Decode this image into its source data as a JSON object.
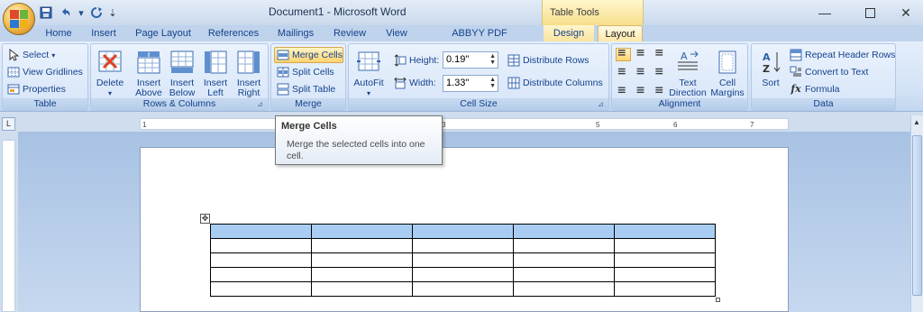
{
  "window": {
    "title": "Document1 - Microsoft Word",
    "context_tools_title": "Table Tools"
  },
  "qat": {
    "undo_icon": "undo-icon",
    "redo_icon": "redo-icon",
    "customize": "▾"
  },
  "tabs": [
    "Home",
    "Insert",
    "Page Layout",
    "References",
    "Mailings",
    "Review",
    "View",
    "ABBYY PDF Transformer+",
    "Design",
    "Layout"
  ],
  "active_tab": "Layout",
  "ribbon": {
    "table_group": {
      "label": "Table",
      "select": "Select",
      "view_gridlines": "View Gridlines",
      "properties": "Properties"
    },
    "rows_cols_group": {
      "label": "Rows & Columns",
      "delete": "Delete",
      "insert_above_1": "Insert",
      "insert_above_2": "Above",
      "insert_below_1": "Insert",
      "insert_below_2": "Below",
      "insert_left_1": "Insert",
      "insert_left_2": "Left",
      "insert_right_1": "Insert",
      "insert_right_2": "Right"
    },
    "merge_group": {
      "label": "Merge",
      "merge_cells": "Merge Cells",
      "split_cells": "Split Cells",
      "split_table": "Split Table"
    },
    "cell_size_group": {
      "label": "Cell Size",
      "autofit": "AutoFit",
      "height_label": "Height:",
      "height_value": "0.19\"",
      "width_label": "Width:",
      "width_value": "1.33\"",
      "distribute_rows": "Distribute Rows",
      "distribute_columns": "Distribute Columns"
    },
    "alignment_group": {
      "label": "Alignment",
      "text_direction_1": "Text",
      "text_direction_2": "Direction",
      "cell_margins_1": "Cell",
      "cell_margins_2": "Margins"
    },
    "data_group": {
      "label": "Data",
      "sort": "Sort",
      "repeat_header_rows": "Repeat Header Rows",
      "convert_to_text": "Convert to Text",
      "formula": "Formula"
    }
  },
  "tooltip": {
    "title": "Merge Cells",
    "body": "Merge the selected cells into one cell."
  },
  "ruler": {
    "ticks": [
      "1",
      "3",
      "5",
      "6",
      "7"
    ]
  },
  "document": {
    "table": {
      "rows": 5,
      "cols": 5,
      "selected_row": 1
    }
  },
  "colors": {
    "ribbon_bg": "#dbe6f6",
    "context_tab": "#f9e49c",
    "selection": "#a9cdf2"
  }
}
